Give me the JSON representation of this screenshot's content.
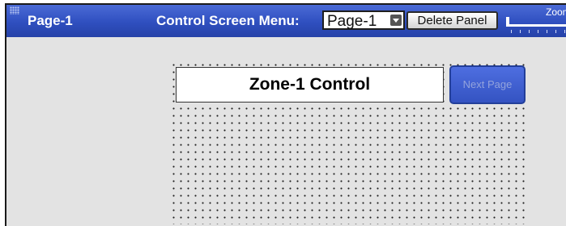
{
  "header": {
    "page_title": "Page-1",
    "menu_label": "Control Screen Menu:",
    "page_select": {
      "value": "Page-1"
    },
    "delete_label": "Delete Panel",
    "zoom_label": "Zoom"
  },
  "canvas": {
    "zone_control_label": "Zone-1 Control",
    "next_page_label": "Next Page"
  },
  "colors": {
    "header_blue": "#2f4fbf",
    "button_blue": "#3f5fd0",
    "panel_gray": "#e3e3e3"
  }
}
